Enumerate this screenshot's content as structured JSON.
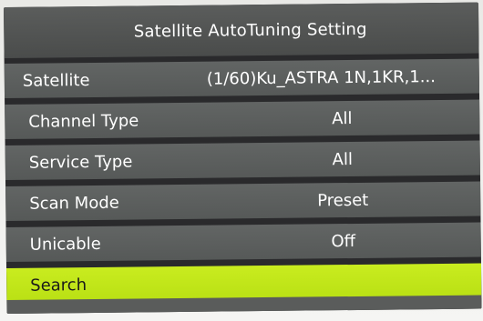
{
  "dialog": {
    "title": "Satellite AutoTuning Setting"
  },
  "menu": {
    "items": [
      {
        "label": "Satellite",
        "value": "(1/60)Ku_ASTRA 1N,1KR,1..."
      },
      {
        "label": "Channel Type",
        "value": "All"
      },
      {
        "label": "Service Type",
        "value": "All"
      },
      {
        "label": "Scan Mode",
        "value": "Preset"
      },
      {
        "label": "Unicable",
        "value": "Off"
      },
      {
        "label": "Search",
        "value": ""
      }
    ],
    "selected_index": 5
  },
  "colors": {
    "highlight": "#c4e81b",
    "row_background": "#5e6160",
    "title_background": "#525453"
  }
}
